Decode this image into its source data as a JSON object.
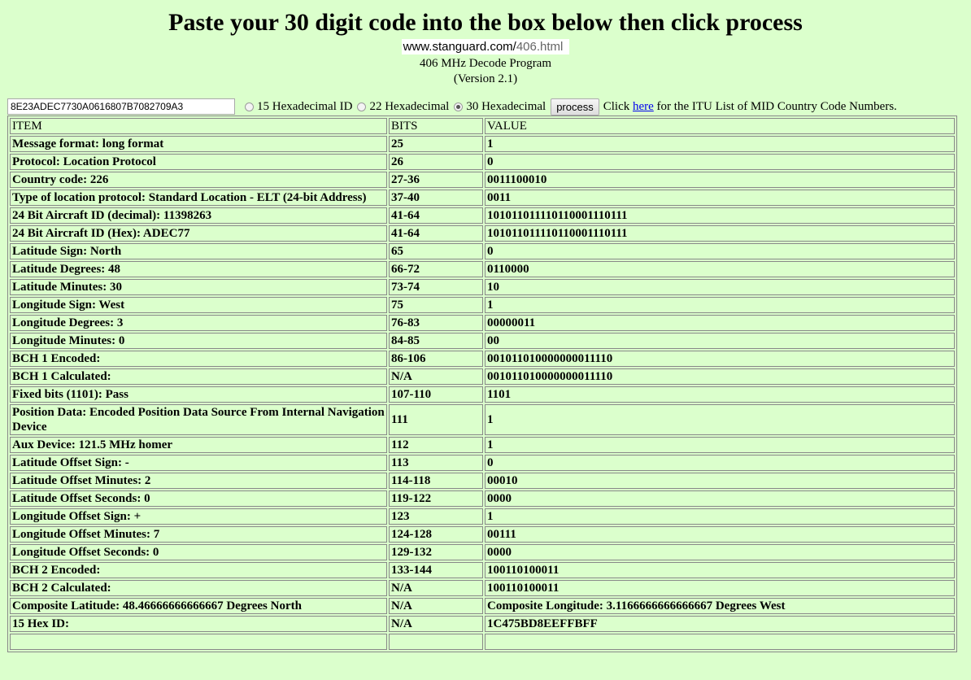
{
  "header": {
    "title": "Paste your 30 digit code into the box below then click process",
    "url_domain": "www.stanguard.com/",
    "url_path": "406.html",
    "subtitle": "406 MHz Decode Program",
    "version": "(Version 2.1)"
  },
  "controls": {
    "code_value": "8E23ADEC7730A0616807B7082709A3",
    "radios": [
      {
        "label": "15 Hexadecimal ID",
        "checked": false
      },
      {
        "label": "22 Hexadecimal",
        "checked": false
      },
      {
        "label": "30 Hexadecimal",
        "checked": true
      }
    ],
    "process_label": "process",
    "click_text": "Click",
    "here_link": "here",
    "after_link_text": "for the ITU List of MID Country Code Numbers."
  },
  "table": {
    "headers": [
      "ITEM",
      "BITS",
      "VALUE"
    ],
    "rows": [
      {
        "item": "Message format: long format",
        "bits": "25",
        "value": "1"
      },
      {
        "item": "Protocol: Location Protocol",
        "bits": "26",
        "value": "0"
      },
      {
        "item": "Country code: 226",
        "bits": "27-36",
        "value": "0011100010"
      },
      {
        "item": "Type of location protocol: Standard Location - ELT (24-bit Address)",
        "bits": "37-40",
        "value": "0011"
      },
      {
        "item": "24 Bit Aircraft ID (decimal): 11398263",
        "bits": "41-64",
        "value": "101011011110110001110111"
      },
      {
        "item": "24 Bit Aircraft ID (Hex): ADEC77",
        "bits": "41-64",
        "value": "101011011110110001110111"
      },
      {
        "item": "Latitude Sign: North",
        "bits": "65",
        "value": "0"
      },
      {
        "item": "Latitude Degrees: 48",
        "bits": "66-72",
        "value": "0110000"
      },
      {
        "item": "Latitude Minutes: 30",
        "bits": "73-74",
        "value": "10"
      },
      {
        "item": "Longitude Sign: West",
        "bits": "75",
        "value": "1"
      },
      {
        "item": "Longitude Degrees: 3",
        "bits": "76-83",
        "value": "00000011"
      },
      {
        "item": "Longitude Minutes: 0",
        "bits": "84-85",
        "value": "00"
      },
      {
        "item": "BCH 1 Encoded:",
        "bits": "86-106",
        "value": "001011010000000011110"
      },
      {
        "item": "BCH 1 Calculated:",
        "bits": "N/A",
        "value": "001011010000000011110"
      },
      {
        "item": "Fixed bits (1101): Pass",
        "bits": "107-110",
        "value": "1101"
      },
      {
        "item": "Position Data: Encoded Position Data Source From Internal Navigation Device",
        "bits": "111",
        "value": "1"
      },
      {
        "item": "Aux Device: 121.5 MHz homer",
        "bits": "112",
        "value": "1"
      },
      {
        "item": "Latitude Offset Sign: -",
        "bits": "113",
        "value": "0"
      },
      {
        "item": "Latitude Offset Minutes: 2",
        "bits": "114-118",
        "value": "00010"
      },
      {
        "item": "Latitude Offset Seconds: 0",
        "bits": "119-122",
        "value": "0000"
      },
      {
        "item": "Longitude Offset Sign: +",
        "bits": "123",
        "value": "1"
      },
      {
        "item": "Longitude Offset Minutes: 7",
        "bits": "124-128",
        "value": "00111"
      },
      {
        "item": "Longitude Offset Seconds: 0",
        "bits": "129-132",
        "value": "0000"
      },
      {
        "item": "BCH 2 Encoded:",
        "bits": "133-144",
        "value": "100110100011"
      },
      {
        "item": "BCH 2 Calculated:",
        "bits": "N/A",
        "value": "100110100011"
      },
      {
        "item": "Composite Latitude: 48.46666666666667 Degrees North",
        "bits": "N/A",
        "value": "Composite Longitude: 3.1166666666666667 Degrees West"
      },
      {
        "item": "15 Hex ID:",
        "bits": "N/A",
        "value": "1C475BD8EEFFBFF"
      }
    ]
  }
}
